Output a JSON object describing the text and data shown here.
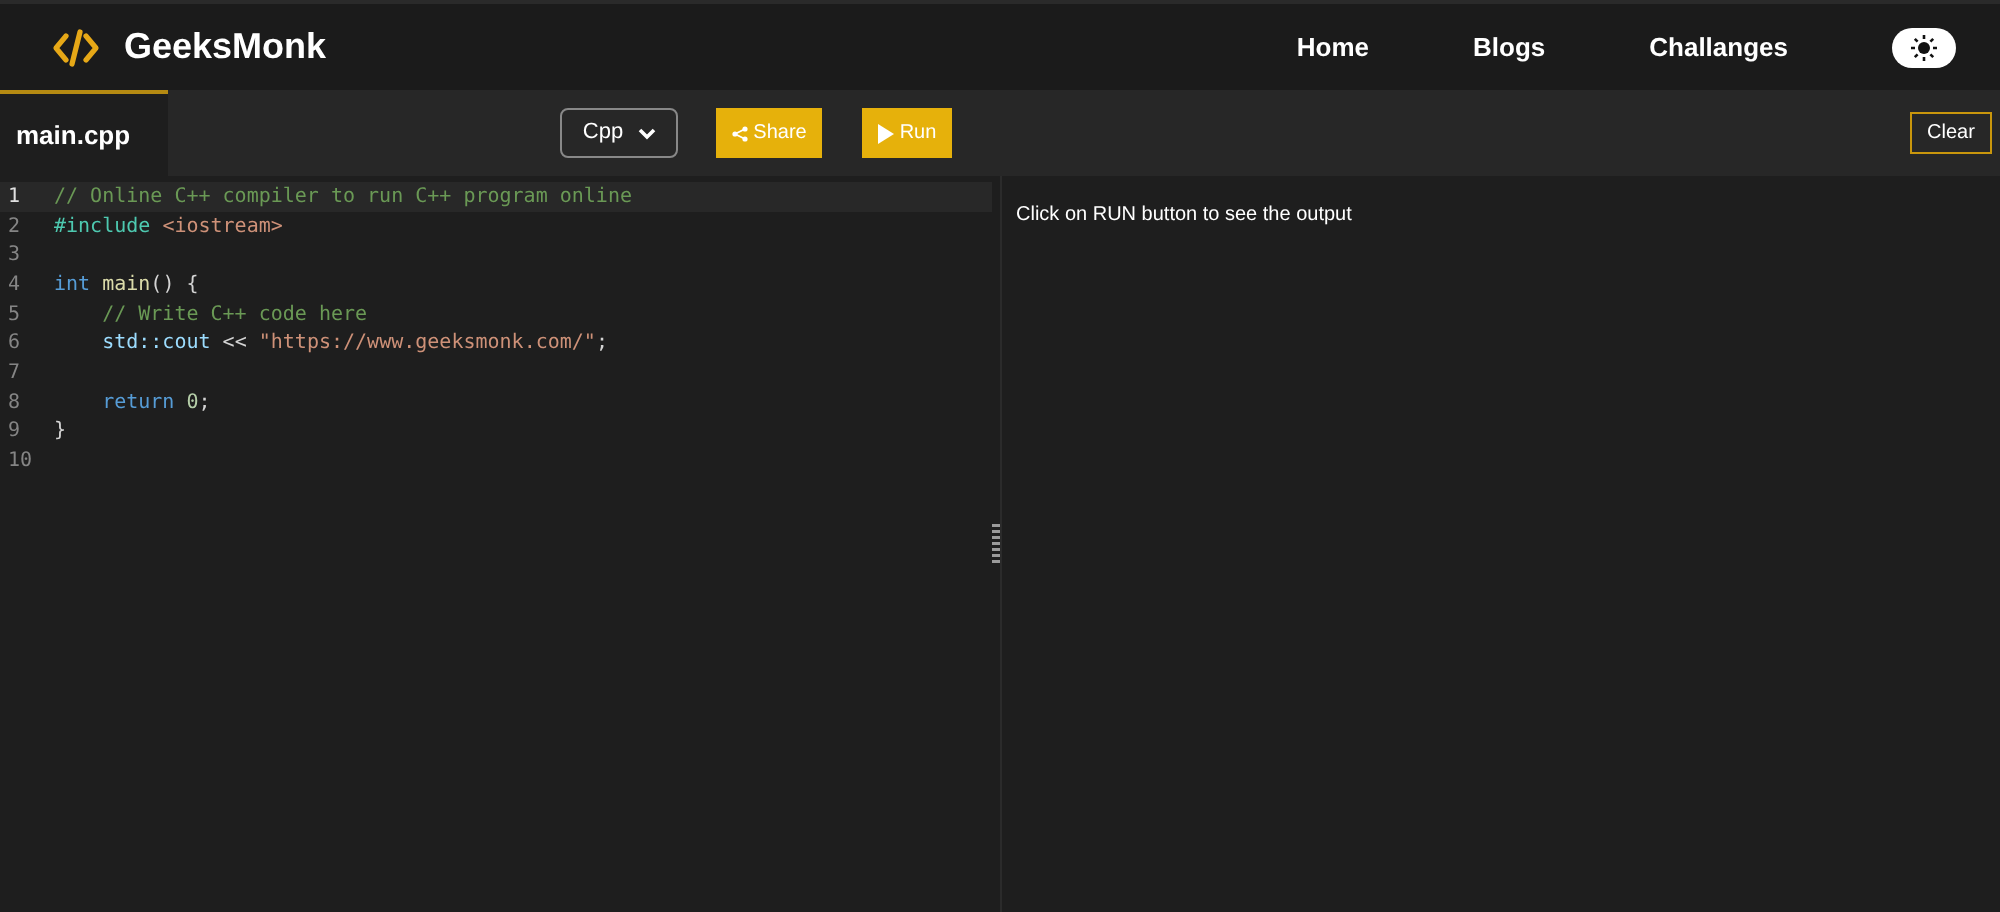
{
  "header": {
    "logo": "GeeksMonk",
    "nav": [
      {
        "label": "Home"
      },
      {
        "label": "Blogs"
      },
      {
        "label": "Challanges"
      }
    ],
    "theme_toggle": {
      "on": false
    }
  },
  "toolbar": {
    "tab": {
      "label": "main.cpp",
      "selected": true
    },
    "language": "Cpp",
    "share": "Share",
    "run": "Run",
    "clear": "Clear"
  },
  "editor": {
    "lines": [
      {
        "number": "1",
        "selected": true,
        "tokens": [
          {
            "text": "// Online C++ compiler to run C++ program online",
            "kind": "comment"
          }
        ]
      },
      {
        "number": "2",
        "selected": false,
        "tokens": [
          {
            "text": "#include ",
            "kind": "preprocessor"
          },
          {
            "text": "<iostream>",
            "kind": "include"
          }
        ]
      },
      {
        "number": "3",
        "selected": false
      },
      {
        "number": "4",
        "selected": false,
        "tokens": [
          {
            "text": "int",
            "kind": "keyword"
          },
          {
            "text": " main",
            "kind": "function"
          },
          {
            "text": "() {",
            "kind": "plain"
          }
        ]
      },
      {
        "number": "5",
        "selected": false,
        "tokens": [
          {
            "text": "    // Write C++ code here",
            "kind": "comment"
          }
        ]
      },
      {
        "number": "6",
        "selected": false,
        "tokens": [
          {
            "text": "    std::cout",
            "kind": "identifier"
          },
          {
            "text": " << ",
            "kind": "plain"
          },
          {
            "text": "\"https://www.geeksmonk.com/\"",
            "kind": "string"
          },
          {
            "text": ";",
            "kind": "plain"
          }
        ]
      },
      {
        "number": "7",
        "selected": false
      },
      {
        "number": "8",
        "selected": false,
        "tokens": [
          {
            "text": "    return",
            "kind": "keyword"
          },
          {
            "text": " 0",
            "kind": "number"
          },
          {
            "text": ";",
            "kind": "plain"
          }
        ]
      },
      {
        "number": "9",
        "selected": false,
        "tokens": [
          {
            "text": "}",
            "kind": "plain"
          }
        ]
      },
      {
        "number": "10",
        "selected": false
      }
    ]
  },
  "output": {
    "message": "Click on RUN button to see the output"
  }
}
